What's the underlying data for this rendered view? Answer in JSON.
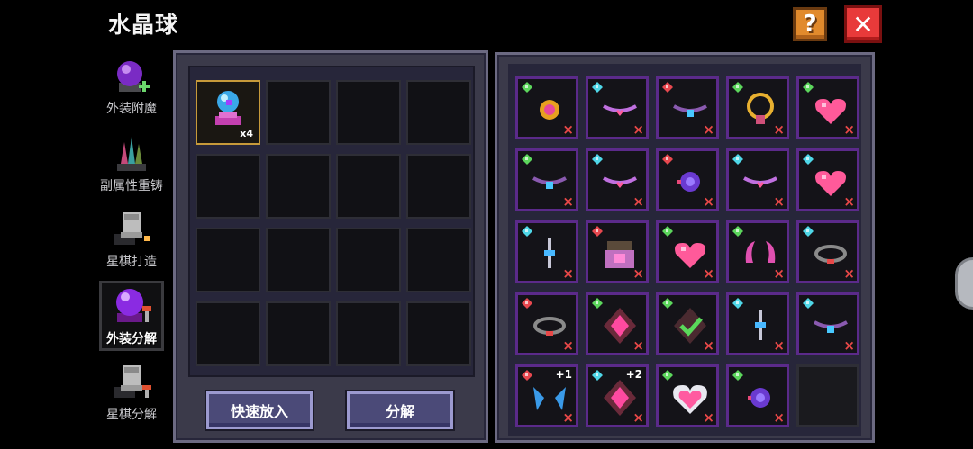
{
  "title": "水晶球",
  "header": {
    "help_label": "?",
    "close_label": "✕"
  },
  "sidebar": {
    "items": [
      {
        "label": "外装附魔",
        "icon": "crystal-ball-plus-icon",
        "active": false
      },
      {
        "label": "副属性重铸",
        "icon": "crystals-icon",
        "active": false
      },
      {
        "label": "星棋打造",
        "icon": "chess-piece-forge-icon",
        "active": false
      },
      {
        "label": "外装分解",
        "icon": "crystal-ball-hammer-icon",
        "active": true
      },
      {
        "label": "星棋分解",
        "icon": "chess-piece-hammer-icon",
        "active": false
      }
    ]
  },
  "inventory": {
    "slots_rows": 4,
    "slots_cols": 4,
    "items": [
      {
        "icon": "crystal-ball-item-icon",
        "count": "x4"
      }
    ]
  },
  "buttons": {
    "quick_add": "快速放入",
    "decompose": "分解"
  },
  "skins": {
    "rows": [
      [
        {
          "icon": "amulet-icon",
          "rarity": "green",
          "plus": ""
        },
        {
          "icon": "heart-choker-icon",
          "rarity": "cyan",
          "plus": ""
        },
        {
          "icon": "gem-choker-icon",
          "rarity": "red",
          "plus": ""
        },
        {
          "icon": "gold-necklace-icon",
          "rarity": "green",
          "plus": ""
        },
        {
          "icon": "heart-icon",
          "rarity": "green",
          "plus": ""
        }
      ],
      [
        {
          "icon": "gem-choker-icon",
          "rarity": "green",
          "plus": ""
        },
        {
          "icon": "heart-choker-icon",
          "rarity": "cyan",
          "plus": ""
        },
        {
          "icon": "crystal-orb-icon",
          "rarity": "red",
          "plus": ""
        },
        {
          "icon": "heart-choker-icon",
          "rarity": "cyan",
          "plus": ""
        },
        {
          "icon": "heart-icon",
          "rarity": "cyan",
          "plus": ""
        }
      ],
      [
        {
          "icon": "sword-pendant-icon",
          "rarity": "cyan",
          "plus": ""
        },
        {
          "icon": "pink-armor-icon",
          "rarity": "red",
          "plus": ""
        },
        {
          "icon": "heart-icon",
          "rarity": "green",
          "plus": ""
        },
        {
          "icon": "horn-pair-icon",
          "rarity": "green",
          "plus": ""
        },
        {
          "icon": "spike-collar-icon",
          "rarity": "cyan",
          "plus": ""
        }
      ],
      [
        {
          "icon": "spike-collar-icon",
          "rarity": "red",
          "plus": ""
        },
        {
          "icon": "pink-gem-emblem-icon",
          "rarity": "green",
          "plus": ""
        },
        {
          "icon": "checkmark-emblem-icon",
          "rarity": "green",
          "plus": ""
        },
        {
          "icon": "sword-pendant-icon",
          "rarity": "cyan",
          "plus": ""
        },
        {
          "icon": "gem-choker-icon",
          "rarity": "cyan",
          "plus": ""
        }
      ],
      [
        {
          "icon": "blue-wings-icon",
          "rarity": "red",
          "plus": "+1"
        },
        {
          "icon": "pink-gem-emblem-icon",
          "rarity": "cyan",
          "plus": "+2"
        },
        {
          "icon": "crystal-heart-icon",
          "rarity": "green",
          "plus": ""
        },
        {
          "icon": "crystal-orb-icon",
          "rarity": "green",
          "plus": ""
        },
        {
          "icon": "",
          "rarity": "",
          "plus": "",
          "empty": true
        }
      ]
    ],
    "remove_mark": "×"
  },
  "colors": {
    "rarity_green": "#5cd65c",
    "rarity_cyan": "#4fd7e8",
    "rarity_red": "#e8484f",
    "slot_border": "#5b2a8a",
    "accent_button": "#4b4a78"
  }
}
